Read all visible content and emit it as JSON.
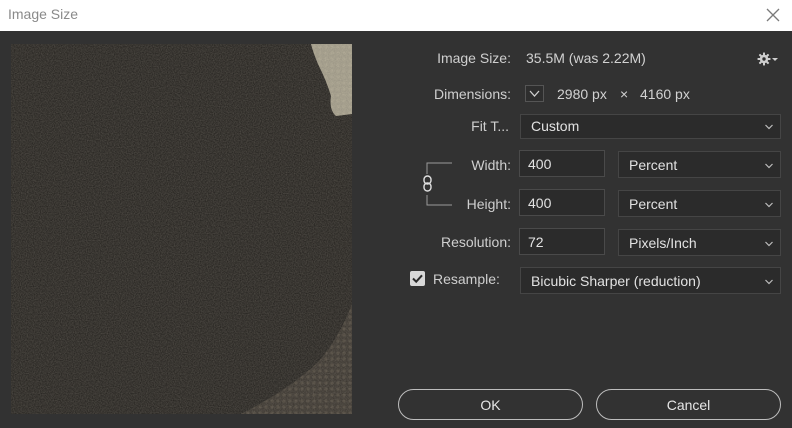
{
  "dialog": {
    "title": "Image Size"
  },
  "info": {
    "image_size_label": "Image Size:",
    "image_size_value": "35.5M (was 2.22M)",
    "dimensions_label": "Dimensions:",
    "dim_width": "2980 px",
    "dim_times": "×",
    "dim_height": "4160 px"
  },
  "fit_to": {
    "label": "Fit T...",
    "selected": "Custom"
  },
  "width": {
    "label": "Width:",
    "value": "400",
    "unit": "Percent"
  },
  "height": {
    "label": "Height:",
    "value": "400",
    "unit": "Percent"
  },
  "resolution": {
    "label": "Resolution:",
    "value": "72",
    "unit": "Pixels/Inch"
  },
  "resample": {
    "label": "Resample:",
    "checked": true,
    "selected": "Bicubic Sharper (reduction)"
  },
  "buttons": {
    "ok": "OK",
    "cancel": "Cancel"
  },
  "icons": {
    "close": "close-icon",
    "settings": "gear-icon",
    "link": "chain-link-icon",
    "dropdown": "chevron-down-icon",
    "check": "checkmark-icon"
  }
}
